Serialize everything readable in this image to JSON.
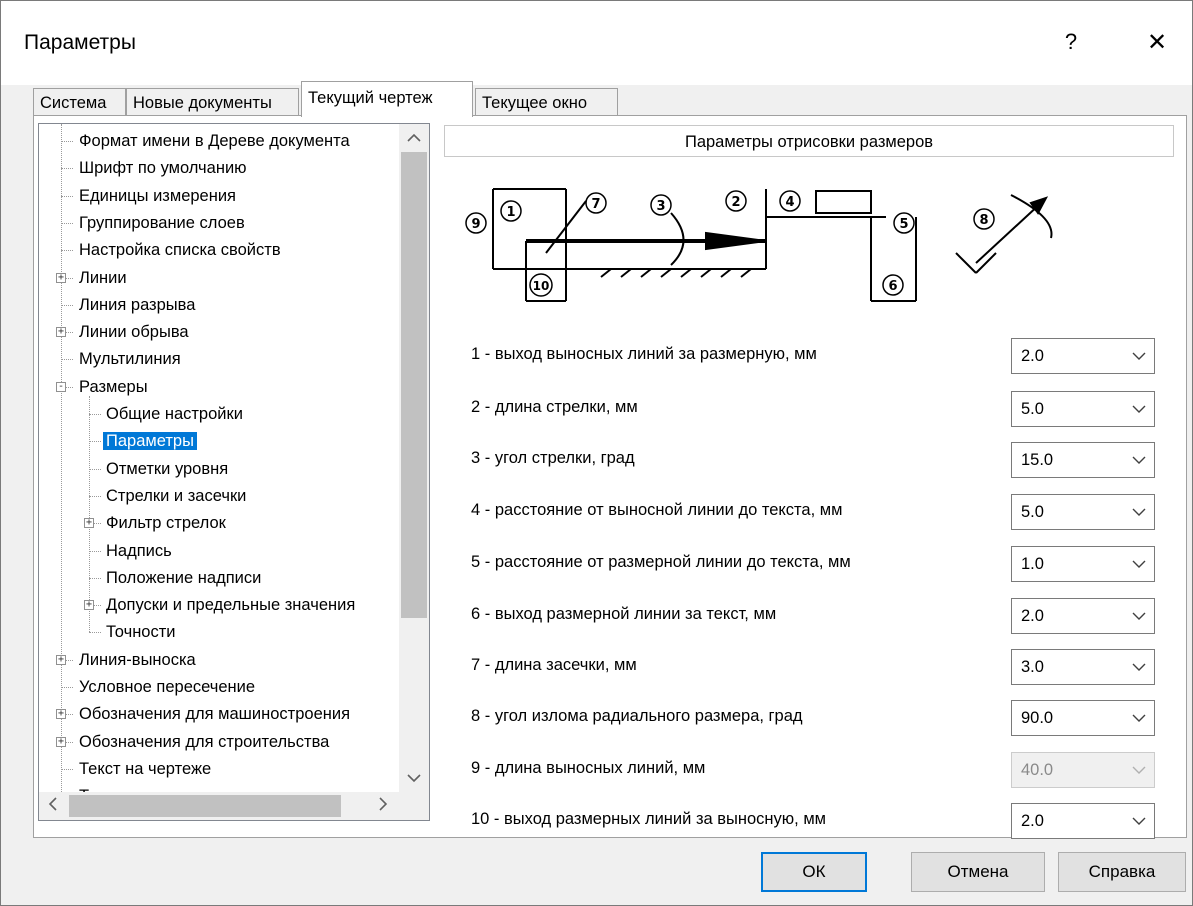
{
  "window": {
    "title": "Параметры",
    "help": "?",
    "close": "✕"
  },
  "tabs": [
    {
      "label": "Система",
      "active": false
    },
    {
      "label": "Новые документы",
      "active": false
    },
    {
      "label": "Текущий чертеж",
      "active": true
    },
    {
      "label": "Текущее окно",
      "active": false
    }
  ],
  "tree": {
    "items": [
      {
        "label": "Формат имени в Дереве документа",
        "level": 0,
        "expander": ""
      },
      {
        "label": "Шрифт по умолчанию",
        "level": 0,
        "expander": ""
      },
      {
        "label": "Единицы измерения",
        "level": 0,
        "expander": ""
      },
      {
        "label": "Группирование слоев",
        "level": 0,
        "expander": ""
      },
      {
        "label": "Настройка списка свойств",
        "level": 0,
        "expander": ""
      },
      {
        "label": "Линии",
        "level": 0,
        "expander": "+"
      },
      {
        "label": "Линия разрыва",
        "level": 0,
        "expander": ""
      },
      {
        "label": "Линии обрыва",
        "level": 0,
        "expander": "+"
      },
      {
        "label": "Мультилиния",
        "level": 0,
        "expander": ""
      },
      {
        "label": "Размеры",
        "level": 0,
        "expander": "−"
      },
      {
        "label": "Общие настройки",
        "level": 1,
        "expander": ""
      },
      {
        "label": "Параметры",
        "level": 1,
        "expander": "",
        "selected": true
      },
      {
        "label": "Отметки уровня",
        "level": 1,
        "expander": ""
      },
      {
        "label": "Стрелки и засечки",
        "level": 1,
        "expander": ""
      },
      {
        "label": "Фильтр стрелок",
        "level": 1,
        "expander": "+"
      },
      {
        "label": "Надпись",
        "level": 1,
        "expander": ""
      },
      {
        "label": "Положение надписи",
        "level": 1,
        "expander": ""
      },
      {
        "label": "Допуски и предельные значения",
        "level": 1,
        "expander": "+"
      },
      {
        "label": "Точности",
        "level": 1,
        "expander": ""
      },
      {
        "label": "Линия-выноска",
        "level": 0,
        "expander": "+"
      },
      {
        "label": "Условное пересечение",
        "level": 0,
        "expander": ""
      },
      {
        "label": "Обозначения для машиностроения",
        "level": 0,
        "expander": "+"
      },
      {
        "label": "Обозначения для строительства",
        "level": 0,
        "expander": "+"
      },
      {
        "label": "Текст на чертеже",
        "level": 0,
        "expander": ""
      },
      {
        "label": "Т",
        "level": 0,
        "expander": ""
      }
    ],
    "scroll_up": "▲",
    "scroll_down": "▼",
    "scroll_left": "<",
    "scroll_right": ">"
  },
  "panel": {
    "header": "Параметры отрисовки размеров",
    "diagram_labels": [
      "1",
      "2",
      "3",
      "4",
      "5",
      "6",
      "7",
      "8",
      "9",
      "10"
    ],
    "params": [
      {
        "label": "1  -  выход выносных линий за размерную, мм",
        "value": "2.0",
        "disabled": false
      },
      {
        "label": "2  -  длина стрелки, мм",
        "value": "5.0",
        "disabled": false
      },
      {
        "label": "3  -  угол стрелки, град",
        "value": "15.0",
        "disabled": false
      },
      {
        "label": "4  -  расстояние от выносной линии до текста, мм",
        "value": "5.0",
        "disabled": false
      },
      {
        "label": "5  -  расстояние от размерной линии до текста, мм",
        "value": "1.0",
        "disabled": false
      },
      {
        "label": "6  -  выход размерной линии за текст, мм",
        "value": "2.0",
        "disabled": false
      },
      {
        "label": "7  -  длина засечки, мм",
        "value": "3.0",
        "disabled": false
      },
      {
        "label": "8  -  угол излома радиального размера, град",
        "value": "90.0",
        "disabled": false
      },
      {
        "label": "9  -  длина выносных линий, мм",
        "value": "40.0",
        "disabled": true
      },
      {
        "label": "10  -  выход размерных линий за выносную, мм",
        "value": "2.0",
        "disabled": false
      }
    ]
  },
  "buttons": {
    "ok": "ОК",
    "cancel": "Отмена",
    "help": "Справка"
  }
}
